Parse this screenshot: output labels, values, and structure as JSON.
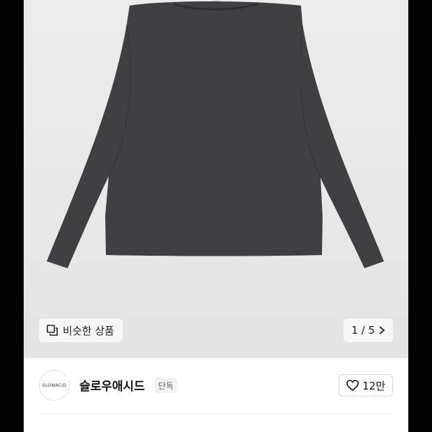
{
  "gallery": {
    "similar_label": "비슷한 상품",
    "pager_text": "1 / 5",
    "colors": {
      "background": "#e9e9e9",
      "garment": "#3f4042"
    },
    "icons": {
      "similar": "similar-products-icon",
      "next": "chevron-right-icon"
    }
  },
  "brand": {
    "logo_text": "SLOWACID",
    "name": "슬로우애시드",
    "tag": "단독"
  },
  "like": {
    "count": "12만",
    "icon": "heart-outline-icon"
  }
}
